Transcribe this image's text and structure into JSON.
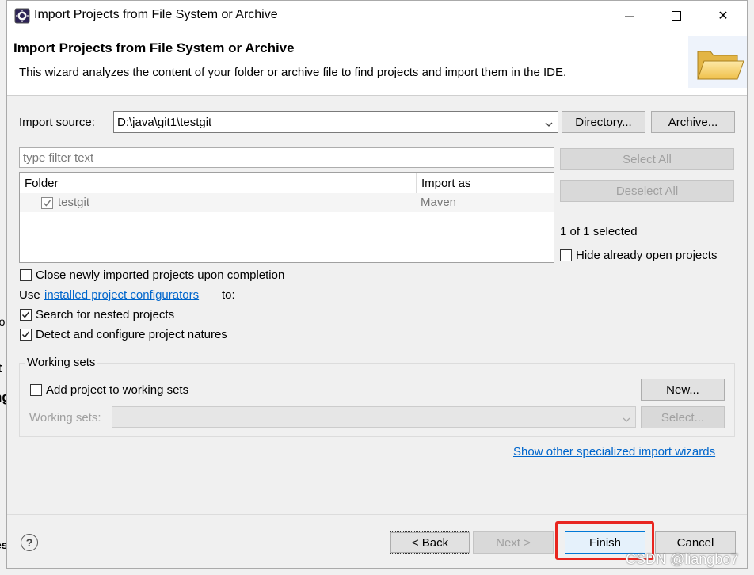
{
  "window": {
    "title": "Import Projects from File System or Archive",
    "controls": {
      "minimize": "—",
      "maximize": "☐",
      "close": "✕"
    }
  },
  "banner": {
    "heading": "Import Projects from File System or Archive",
    "description": "This wizard analyzes the content of your folder or archive file to find projects and import them in the IDE."
  },
  "import_source": {
    "label": "Import source:",
    "value": "D:\\java\\git1\\testgit",
    "directory_button": "Directory...",
    "archive_button": "Archive..."
  },
  "filter": {
    "placeholder": "type filter text"
  },
  "buttons": {
    "select_all": "Select All",
    "deselect_all": "Deselect All"
  },
  "table": {
    "columns": [
      "Folder",
      "Import as"
    ],
    "rows": [
      {
        "folder": "testgit",
        "import_as": "Maven",
        "checked": true
      }
    ]
  },
  "selection_status": "1 of 1 selected",
  "hide_open_projects": "Hide already open projects",
  "options": {
    "close_projects": "Close newly imported projects upon completion",
    "use_prefix": "Use",
    "configurators_link": "installed project configurators",
    "use_suffix": "to:",
    "search_nested": "Search for nested projects",
    "detect_natures": "Detect and configure project natures"
  },
  "working_sets": {
    "legend": "Working sets",
    "add_label": "Add project to working sets",
    "new_button": "New...",
    "sets_label": "Working sets:",
    "select_button": "Select..."
  },
  "specialized_link": "Show other specialized import wizards",
  "footer": {
    "back": "< Back",
    "next": "Next >",
    "finish": "Finish",
    "cancel": "Cancel",
    "help": "?"
  },
  "watermark": "CSDN @liangbo7",
  "background_fragments": {
    "a": "ro",
    "b": "it",
    "c": "ng",
    "d": "es"
  },
  "colors": {
    "link": "#0066cc",
    "highlight": "#e8251f",
    "accent": "#0078d7"
  }
}
